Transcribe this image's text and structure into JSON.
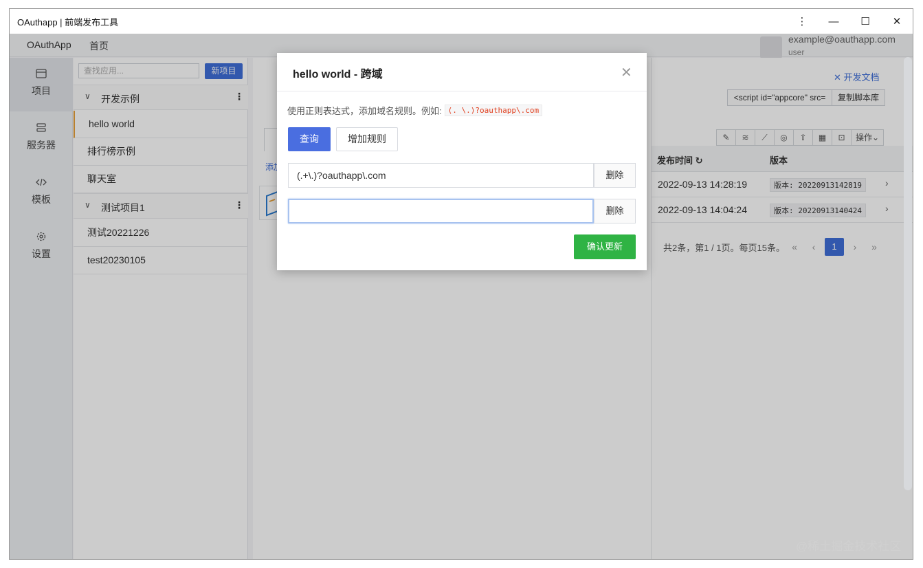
{
  "window": {
    "title": "OAuthapp | 前端发布工具",
    "controls": [
      "⋮",
      "—",
      "☐",
      "✕"
    ]
  },
  "menubar": {
    "brand": "OAuthApp",
    "home": "首页",
    "user_email": "example@oauthapp.com",
    "user_role": "user"
  },
  "nav": [
    {
      "label": "项目",
      "icon": "window-icon",
      "active": true
    },
    {
      "label": "服务器",
      "icon": "server-icon",
      "active": false
    },
    {
      "label": "模板",
      "icon": "code-icon",
      "active": false
    },
    {
      "label": "设置",
      "icon": "gear-icon",
      "active": false
    }
  ],
  "apps": {
    "search_placeholder": "查找应用...",
    "new_button": "新项目",
    "groups": [
      {
        "name": "开发示例",
        "items": [
          "hello world",
          "排行榜示例",
          "聊天室"
        ]
      },
      {
        "name": "测试项目1",
        "items": [
          "测试20221226",
          "test20230105"
        ]
      }
    ]
  },
  "main": {
    "dev_doc": "开发文档",
    "script_snippet": "<script id=\"appcore\" src=",
    "copy_button": "复制脚本库",
    "toolbar_action": "操作",
    "add_link": "添加",
    "table_headers": {
      "time": "发布时间",
      "version": "版本"
    },
    "rows": [
      {
        "time": "2022-09-13 14:28:19",
        "version": "版本: 20220913142819"
      },
      {
        "time": "2022-09-13 14:04:24",
        "version": "版本: 20220913140424"
      }
    ],
    "pager": {
      "summary": "共2条，第1 / 1页。每页15条。",
      "current": "1"
    }
  },
  "modal": {
    "title": "hello world - 跨域",
    "hint": "使用正则表达式，添加域名规则。例如:",
    "example": "(. \\.)?oauthapp\\.com",
    "query_button": "查询",
    "add_rule_button": "增加规则",
    "rules": [
      "(.+\\.)?oauthapp\\.com",
      ""
    ],
    "delete_label": "删除",
    "confirm_button": "确认更新"
  },
  "watermark": "@稀土掘金技术社区",
  "colors": {
    "accent": "#3f6ed9",
    "confirm": "#2fb344",
    "active_marker": "#e8a13a",
    "code_red": "#e0401f"
  }
}
